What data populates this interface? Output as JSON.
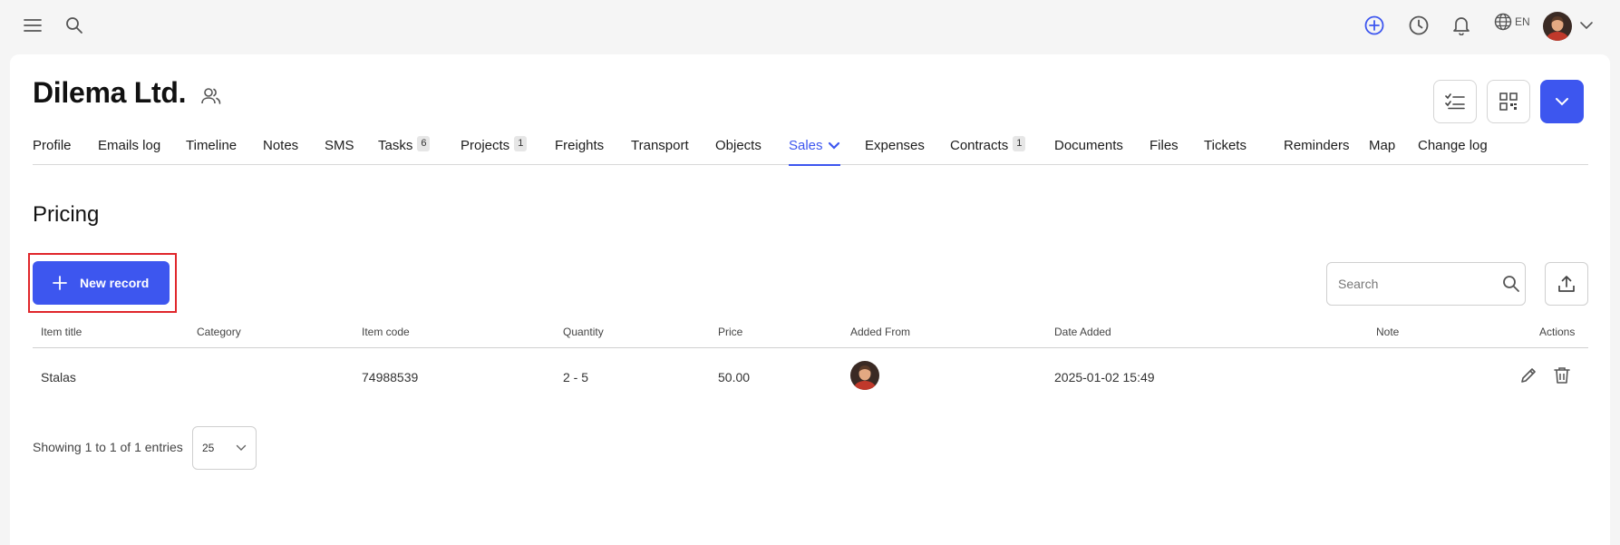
{
  "topbar": {
    "icons": [
      "menu-icon",
      "search-icon",
      "add-circle-icon",
      "history-clock-icon",
      "bell-icon",
      "globe-icon",
      "chevron-down-icon"
    ],
    "language": "EN",
    "accent": "#3d56ef"
  },
  "header": {
    "title": "Dilema Ltd.",
    "title_icon": "people-icon",
    "buttons": [
      "checklist-icon",
      "qr-code-icon",
      "chevron-down-icon"
    ]
  },
  "tabs": [
    {
      "label": "Profile"
    },
    {
      "label": "Emails log"
    },
    {
      "label": "Timeline"
    },
    {
      "label": "Notes"
    },
    {
      "label": "SMS"
    },
    {
      "label": "Tasks",
      "badge": "6"
    },
    {
      "label": "Projects",
      "badge": "1"
    },
    {
      "label": "Freights"
    },
    {
      "label": "Transport"
    },
    {
      "label": "Objects"
    },
    {
      "label": "Sales",
      "active": true
    },
    {
      "label": "Expenses"
    },
    {
      "label": "Contracts",
      "badge": "1"
    },
    {
      "label": "Documents"
    },
    {
      "label": "Files"
    },
    {
      "label": "Tickets"
    },
    {
      "label": "Reminders"
    },
    {
      "label": "Map"
    },
    {
      "label": "Change log"
    }
  ],
  "section": {
    "title": "Pricing",
    "new_record_label": "New record",
    "search_placeholder": "Search"
  },
  "table": {
    "columns": [
      "Item title",
      "Category",
      "Item code",
      "Quantity",
      "Price",
      "Added From",
      "Date Added",
      "Note",
      "Actions"
    ],
    "rows": [
      {
        "item_title": "Stalas",
        "category": "",
        "item_code": "74988539",
        "quantity": "2 - 5",
        "price": "50.00",
        "added_from": "avatar",
        "date_added": "2025-01-02 15:49",
        "note": ""
      }
    ]
  },
  "footer": {
    "showing": "Showing 1 to 1 of 1 entries",
    "page_size": "25"
  }
}
